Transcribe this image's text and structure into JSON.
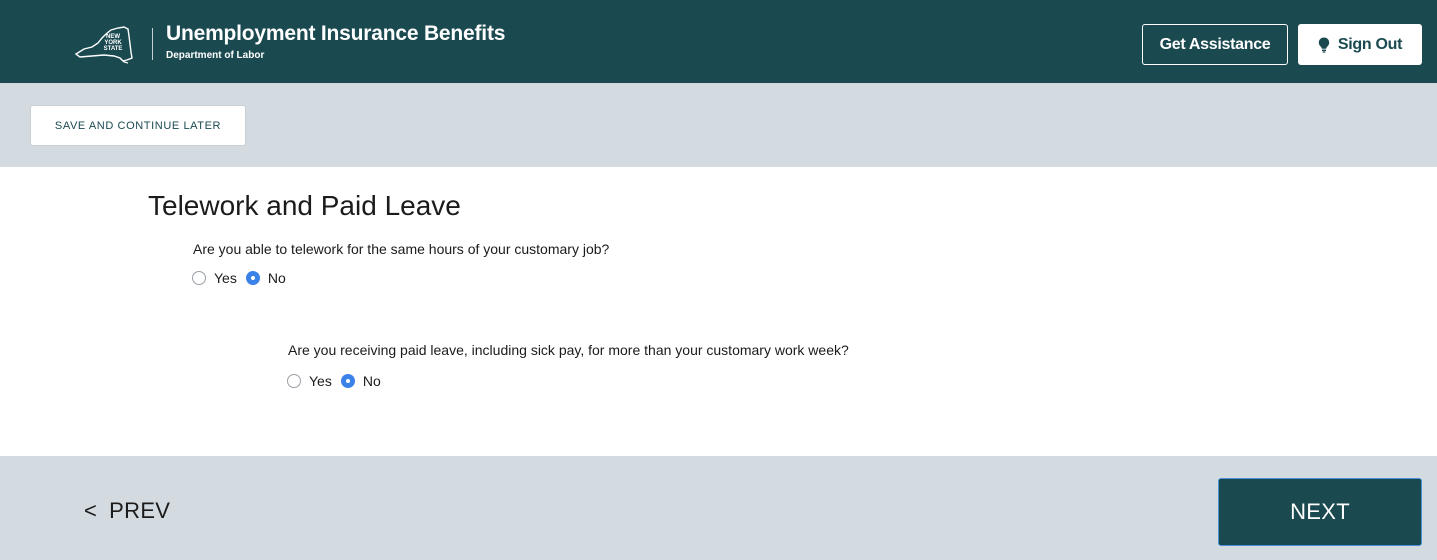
{
  "header": {
    "logo_text": "NEW YORK STATE",
    "title": "Unemployment Insurance Benefits",
    "subtitle": "Department of Labor",
    "assist_label": "Get Assistance",
    "signout_label": "Sign Out",
    "signout_icon": "lightbulb-icon",
    "background_color": "#1a4a50"
  },
  "toolbar": {
    "save_label": "SAVE AND CONTINUE LATER"
  },
  "main": {
    "section_title": "Telework and Paid Leave",
    "questions": [
      {
        "text": "Are you able to telework for the same hours of your customary job?",
        "options": [
          {
            "label": "Yes",
            "checked": false
          },
          {
            "label": "No",
            "checked": true
          }
        ]
      },
      {
        "text": "Are you receiving paid leave, including sick pay, for more than your customary work week?",
        "options": [
          {
            "label": "Yes",
            "checked": false
          },
          {
            "label": "No",
            "checked": true
          }
        ]
      }
    ]
  },
  "footer": {
    "prev_symbol": "<",
    "prev_label": "PREV",
    "next_label": "NEXT"
  },
  "colors": {
    "accent_radio": "#3b82e8",
    "bar_background": "#d3dbe0"
  }
}
